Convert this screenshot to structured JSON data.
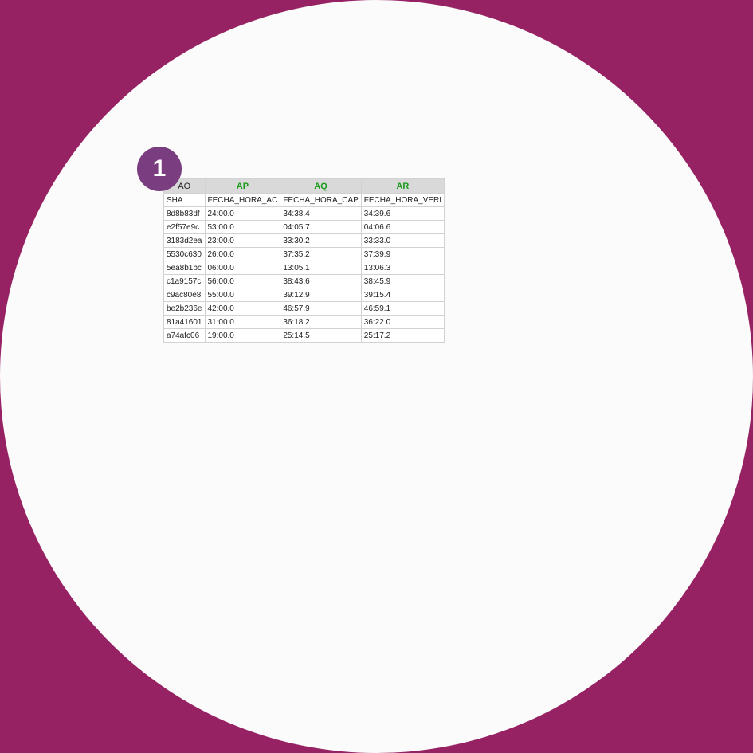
{
  "badge": {
    "number": "1"
  },
  "colors": {
    "background": "#962264",
    "circle": "#fbfbfb",
    "badge": "#7a3d7f",
    "header_green": "#1a9b1a"
  },
  "sheet": {
    "column_letters": [
      "AO",
      "AP",
      "AQ",
      "AR"
    ],
    "header_row": [
      "SHA",
      "FECHA_HORA_AC",
      "FECHA_HORA_CAP",
      "FECHA_HORA_VERI"
    ],
    "rows": [
      [
        "8d8b83df",
        "24:00.0",
        "34:38.4",
        "34:39.6"
      ],
      [
        "e2f57e9c",
        "53:00.0",
        "04:05.7",
        "04:06.6"
      ],
      [
        "3183d2ea",
        "23:00.0",
        "33:30.2",
        "33:33.0"
      ],
      [
        "5530c630",
        "26:00.0",
        "37:35.2",
        "37:39.9"
      ],
      [
        "5ea8b1bc",
        "06:00.0",
        "13:05.1",
        "13:06.3"
      ],
      [
        "c1a9157c",
        "56:00.0",
        "38:43.6",
        "38:45.9"
      ],
      [
        "c9ac80e8",
        "55:00.0",
        "39:12.9",
        "39:15.4"
      ],
      [
        "be2b236e",
        "42:00.0",
        "46:57.9",
        "46:59.1"
      ],
      [
        "81a41601",
        "31:00.0",
        "36:18.2",
        "36:22.0"
      ],
      [
        "a74afc06",
        "19:00.0",
        "25:14.5",
        "25:17.2"
      ]
    ]
  }
}
